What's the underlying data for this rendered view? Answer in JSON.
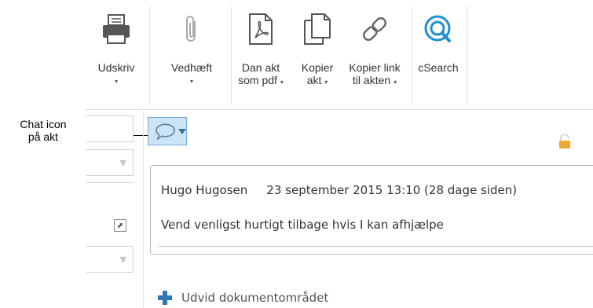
{
  "ribbon": {
    "print": {
      "label": "Udskriv",
      "icon": "printer-icon"
    },
    "attach": {
      "label": "Vedhæft",
      "icon": "paperclip-icon"
    },
    "pdf": {
      "line1": "Dan akt",
      "line2": "som pdf",
      "icon": "pdf-document-icon"
    },
    "copy": {
      "line1": "Kopier",
      "line2": "akt",
      "icon": "copy-document-icon"
    },
    "copylink": {
      "line1": "Kopier link",
      "line2": "til akten",
      "icon": "link-icon"
    },
    "csearch": {
      "label": "cSearch",
      "icon": "csearch-icon"
    },
    "dropdown_arrow": "▾"
  },
  "callout": {
    "line1": "Chat icon",
    "line2": "på akt"
  },
  "chat": {
    "author": "Hugo Hugosen",
    "date": "23 september 2015 13:10 (28 dage siden)",
    "message": "Vend venligst hurtigt tilbage hvis I kan afhjælpe"
  },
  "expand": {
    "label": "Udvid dokumentområdet"
  },
  "colors": {
    "accent": "#2e75b6",
    "chat_button_bg": "#cde4f7",
    "lock": "#f0a830"
  }
}
